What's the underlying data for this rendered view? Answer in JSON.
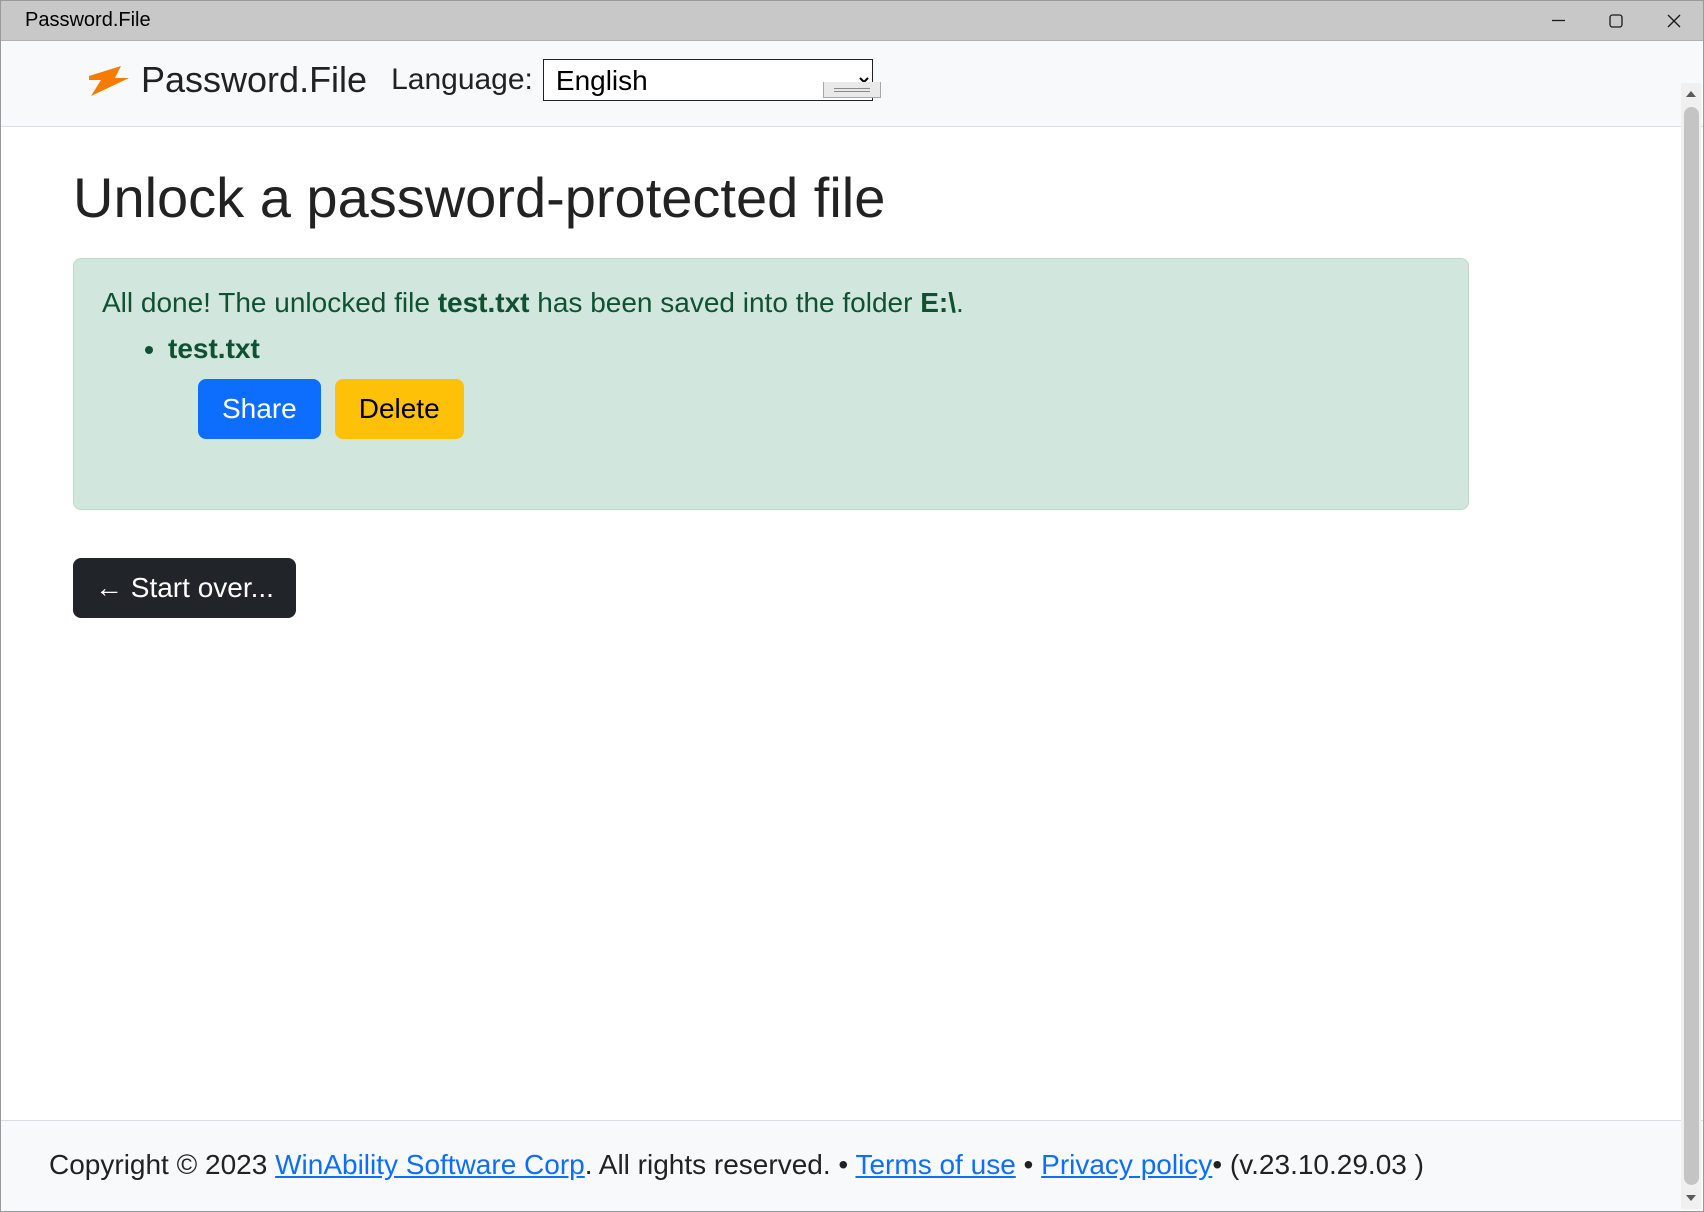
{
  "window": {
    "title": "Password.File"
  },
  "header": {
    "appname": "Password.File",
    "language_label": "Language:",
    "language_value": "English"
  },
  "main": {
    "heading": "Unlock a password-protected file",
    "alert": {
      "prefix": "All done! The unlocked file ",
      "filename_inline": "test.txt",
      "middle": " has been saved into the folder ",
      "folder": "E:\\",
      "suffix": ".",
      "list_item": "test.txt",
      "share_label": "Share",
      "delete_label": "Delete"
    },
    "start_over_label": "← Start over..."
  },
  "footer": {
    "copyright_prefix": "Copyright © 2023 ",
    "company_link": "WinAbility Software Corp",
    "rights": ". All rights reserved. • ",
    "terms_link": "Terms of use",
    "sep": " • ",
    "privacy_link": "Privacy policy",
    "version": "• (v.23.10.29.03 )"
  }
}
